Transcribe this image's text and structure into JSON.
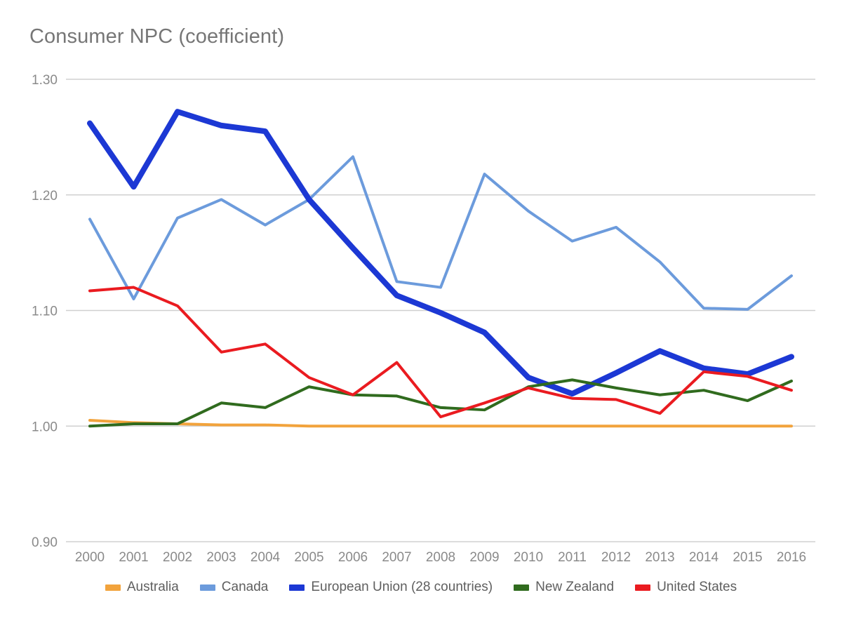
{
  "chart_data": {
    "type": "line",
    "title": "Consumer NPC (coefficient)",
    "xlabel": "",
    "ylabel": "",
    "ylim": [
      0.9,
      1.3
    ],
    "yticks": [
      "0.90",
      "1.00",
      "1.10",
      "1.20",
      "1.30"
    ],
    "ytick_values": [
      0.9,
      1.0,
      1.1,
      1.2,
      1.3
    ],
    "grid": true,
    "legend_position": "bottom",
    "categories": [
      "2000",
      "2001",
      "2002",
      "2003",
      "2004",
      "2005",
      "2006",
      "2007",
      "2008",
      "2009",
      "2010",
      "2011",
      "2012",
      "2013",
      "2014",
      "2015",
      "2016"
    ],
    "x": [
      2000,
      2001,
      2002,
      2003,
      2004,
      2005,
      2006,
      2007,
      2008,
      2009,
      2010,
      2011,
      2012,
      2013,
      2014,
      2015,
      2016
    ],
    "series": [
      {
        "name": "Australia",
        "color": "#F2A33C",
        "width": 4,
        "values": [
          1.005,
          1.003,
          1.002,
          1.001,
          1.001,
          1.0,
          1.0,
          1.0,
          1.0,
          1.0,
          1.0,
          1.0,
          1.0,
          1.0,
          1.0,
          1.0,
          1.0
        ]
      },
      {
        "name": "Canada",
        "color": "#6C9BDC",
        "width": 4,
        "values": [
          1.179,
          1.11,
          1.18,
          1.196,
          1.174,
          1.196,
          1.233,
          1.125,
          1.12,
          1.218,
          1.186,
          1.16,
          1.172,
          1.142,
          1.102,
          1.101,
          1.13
        ]
      },
      {
        "name": "European Union (28 countries)",
        "color": "#1C38D4",
        "width": 8,
        "values": [
          1.262,
          1.207,
          1.272,
          1.26,
          1.255,
          1.196,
          1.154,
          1.113,
          1.098,
          1.081,
          1.042,
          1.028,
          1.046,
          1.065,
          1.05,
          1.045,
          1.06
        ]
      },
      {
        "name": "New Zealand",
        "color": "#306B1E",
        "width": 4,
        "values": [
          1.0,
          1.002,
          1.002,
          1.02,
          1.016,
          1.034,
          1.027,
          1.026,
          1.016,
          1.014,
          1.034,
          1.04,
          1.033,
          1.027,
          1.031,
          1.022,
          1.039
        ]
      },
      {
        "name": "United States",
        "color": "#EA1B20",
        "width": 4,
        "values": [
          1.117,
          1.12,
          1.104,
          1.064,
          1.071,
          1.042,
          1.027,
          1.055,
          1.008,
          1.02,
          1.033,
          1.024,
          1.023,
          1.011,
          1.047,
          1.043,
          1.031
        ]
      }
    ]
  }
}
